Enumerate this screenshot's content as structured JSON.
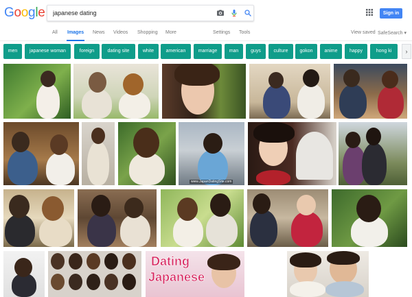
{
  "logo": {
    "letters": [
      "G",
      "o",
      "o",
      "g",
      "l",
      "e"
    ],
    "colors": [
      "#4285f4",
      "#ea4335",
      "#fbbc05",
      "#4285f4",
      "#34a853",
      "#ea4335"
    ]
  },
  "search": {
    "query": "japanese dating"
  },
  "header": {
    "sign_in": "Sign in"
  },
  "tabs": {
    "items": [
      "All",
      "Images",
      "News",
      "Videos",
      "Shopping",
      "More"
    ],
    "active": "Images",
    "settings": "Settings",
    "tools": "Tools",
    "view_saved": "View saved",
    "safesearch": "SafeSearch ▾"
  },
  "chips": [
    "men",
    "japanese woman",
    "foreign",
    "dating site",
    "white",
    "american",
    "marriage",
    "man",
    "guys",
    "culture",
    "gokon",
    "anime",
    "happy",
    "hong ki"
  ],
  "chip_arrow": "›",
  "accent_color": "#0f9d8a",
  "images": {
    "watermark_japandating": "www.JapanDatingSite.com",
    "collage_title_1": "Dating",
    "collage_title_2": "Japanese"
  }
}
